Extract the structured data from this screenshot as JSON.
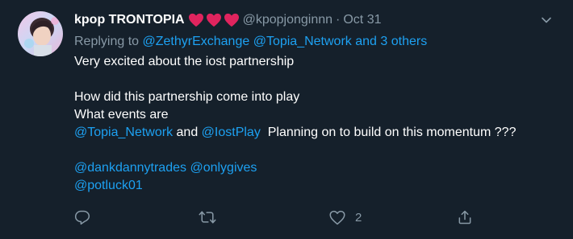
{
  "user": {
    "display_name": "kpop TRONTOPIA",
    "emojis": [
      "red-heart",
      "red-heart",
      "red-heart"
    ],
    "handle": "@kpopjonginnn",
    "separator": "·",
    "time": "Oct 31"
  },
  "reply": {
    "prefix": "Replying to",
    "mention1": "@ZethyrExchange",
    "mention2": "@Topia_Network",
    "others": "and 3 others"
  },
  "body": {
    "line1": "Very excited about the iost partnership",
    "line2": "How did this partnership come into play",
    "line3": "What events are",
    "mention_topia": "@Topia_Network",
    "and": " and ",
    "mention_iost": "@IostPlay",
    "line4_rest": "  Planning on to build on this momentum ???",
    "mention_danny": "@dankdannytrades",
    "mention_onlygives": "@onlygives",
    "mention_potluck": "@potluck01"
  },
  "actions": {
    "reply_count": "",
    "retweet_count": "",
    "like_count": "2",
    "icons": [
      "reply-icon",
      "retweet-icon",
      "like-icon",
      "share-icon"
    ]
  },
  "colors": {
    "background": "#15202b",
    "link": "#1da1f2",
    "secondary": "#8899a6",
    "heart": "#e0245e"
  }
}
